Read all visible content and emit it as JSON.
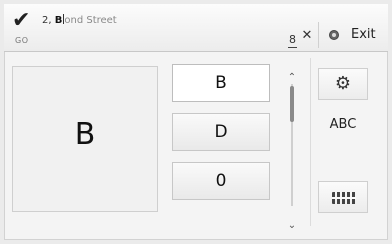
{
  "header": {
    "check_icon": "checkmark-icon",
    "go_label": "GO",
    "input": {
      "prefix": "2, ",
      "typed": "B",
      "suggestion": "ond Street"
    },
    "match_count": "8",
    "clear_label": "✕",
    "exit_label": "Exit",
    "exit_icon": "exit-icon"
  },
  "preview": {
    "letter": "B"
  },
  "candidates": [
    "B",
    "D",
    "0"
  ],
  "scroll": {
    "up": "⌃",
    "down": "⌄"
  },
  "side": {
    "settings_icon": "settings-gear-icon",
    "abc_label": "ABC",
    "keyboard_icon": "keyboard-icon"
  }
}
